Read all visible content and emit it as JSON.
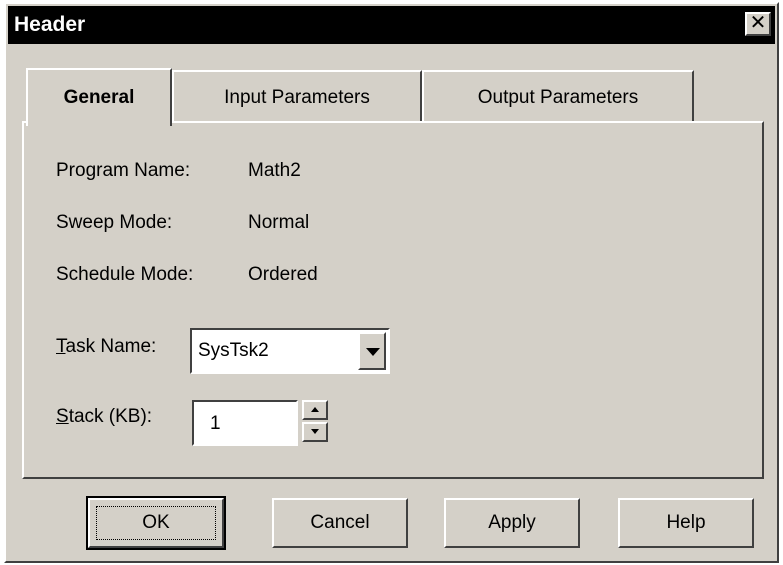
{
  "window": {
    "title": "Header",
    "close_glyph": "✕"
  },
  "tabs": [
    {
      "label": "General",
      "active": true
    },
    {
      "label": "Input Parameters",
      "active": false
    },
    {
      "label": "Output Parameters",
      "active": false
    }
  ],
  "general": {
    "program_name_label": "Program Name:",
    "program_name_value": "Math2",
    "sweep_mode_label": "Sweep Mode:",
    "sweep_mode_value": "Normal",
    "schedule_mode_label": "Schedule Mode:",
    "schedule_mode_value": "Ordered",
    "task_name_label_accel": "T",
    "task_name_label_rest": "ask Name:",
    "task_name_value": "SysTsk2",
    "stack_label_accel": "S",
    "stack_label_rest": "tack (KB):",
    "stack_value": "1"
  },
  "buttons": {
    "ok": "OK",
    "cancel": "Cancel",
    "apply": "Apply",
    "help": "Help"
  },
  "icons": {
    "close": "close-icon",
    "dropdown": "chevron-down-icon",
    "spin_up": "arrow-up-icon",
    "spin_down": "arrow-down-icon"
  }
}
